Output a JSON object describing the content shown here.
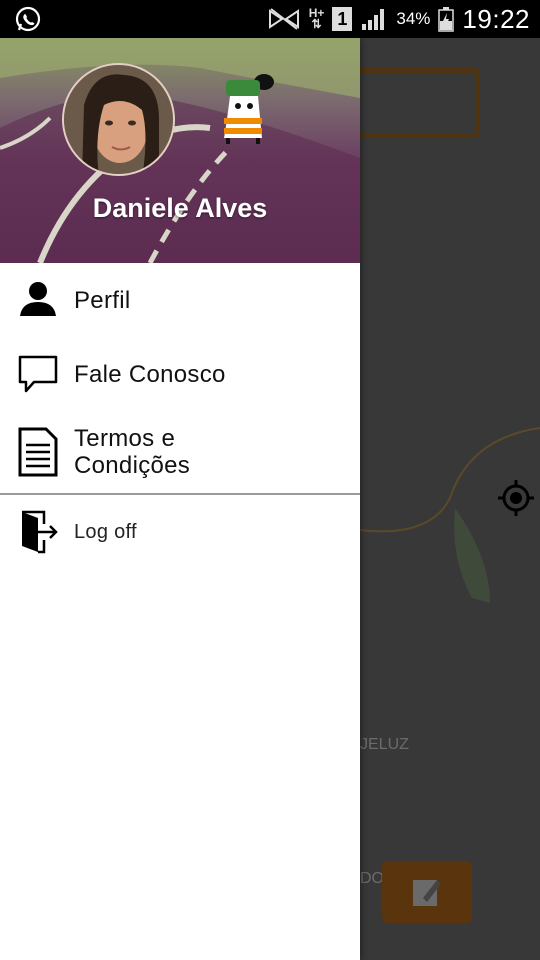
{
  "status_bar": {
    "battery_percent": "34%",
    "time": "19:22",
    "sim_badge": "1",
    "network_label": "H+"
  },
  "drawer": {
    "user_name": "Daniele Alves",
    "menu": [
      {
        "label": "Perfil",
        "icon": "person-icon"
      },
      {
        "label": "Fale Conosco",
        "icon": "chat-icon"
      },
      {
        "label": "Termos e\nCondições",
        "icon": "document-icon"
      }
    ],
    "logoff_label": "Log off"
  },
  "map_background": {
    "partial_text_1": "JELUZ",
    "partial_text_2": "DO"
  },
  "colors": {
    "accent": "#f08a00",
    "drawer_bg": "#ffffff",
    "header_tint": "#6b3d62"
  }
}
